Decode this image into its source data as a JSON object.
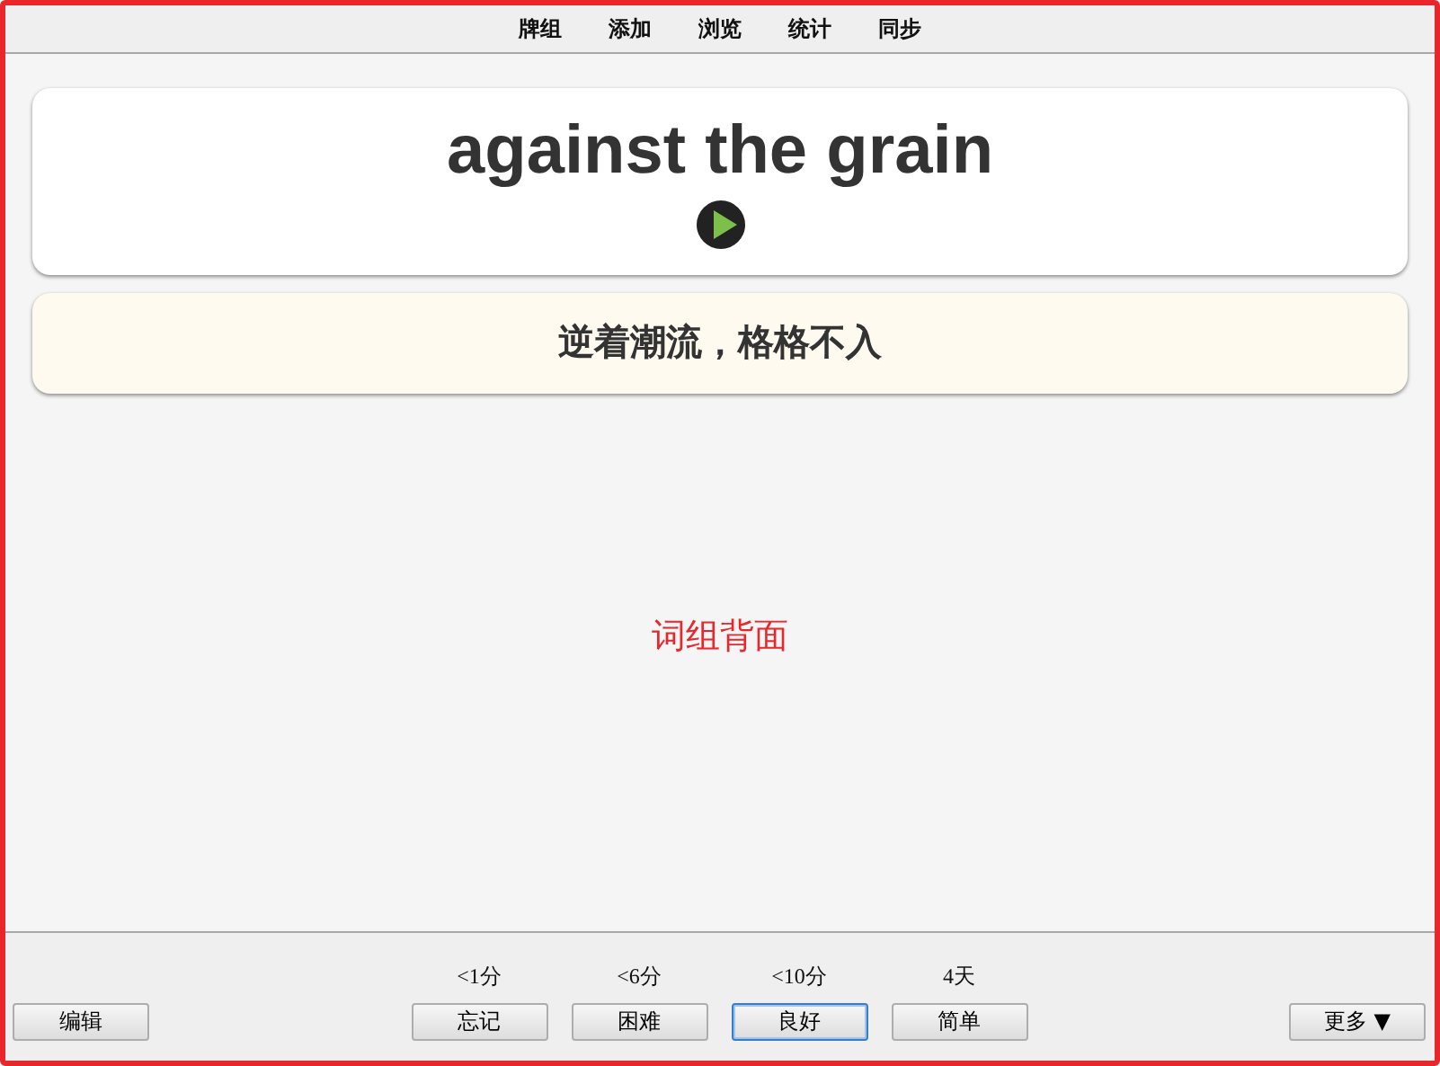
{
  "menu": [
    "牌组",
    "添加",
    "浏览",
    "统计",
    "同步"
  ],
  "front": {
    "text": "against the grain"
  },
  "back": {
    "text": "逆着潮流，格格不入"
  },
  "note": "词组背面",
  "edit_button": "编辑",
  "answers": [
    {
      "interval": "<1分",
      "label": "忘记",
      "selected": false
    },
    {
      "interval": "<6分",
      "label": "困难",
      "selected": false
    },
    {
      "interval": "<10分",
      "label": "良好",
      "selected": true
    },
    {
      "interval": "4天",
      "label": "简单",
      "selected": false
    }
  ],
  "more_button": "更多 ▼"
}
